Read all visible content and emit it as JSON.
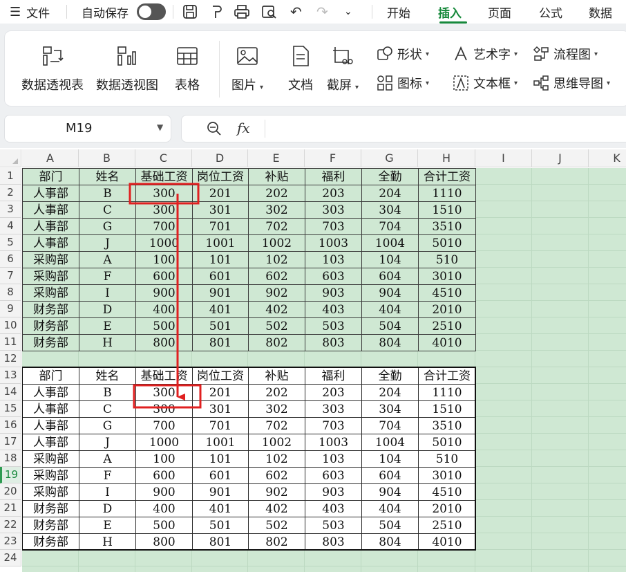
{
  "menubar": {
    "menu_label": "文件",
    "autosave_label": "自动保存",
    "tabs": [
      "开始",
      "插入",
      "页面",
      "公式",
      "数据"
    ],
    "active_tab": "插入",
    "accent_color": "#17893c"
  },
  "ribbon": {
    "big_buttons": [
      {
        "label": "数据透视表",
        "icon": "pivot-table-icon"
      },
      {
        "label": "数据透视图",
        "icon": "pivot-chart-icon"
      },
      {
        "label": "表格",
        "icon": "table-icon"
      },
      {
        "label": "图片",
        "icon": "picture-icon"
      },
      {
        "label": "文档",
        "icon": "document-icon"
      },
      {
        "label": "截屏",
        "icon": "screenshot-icon"
      }
    ],
    "small_buttons": [
      {
        "label": "形状",
        "icon": "shape-icon"
      },
      {
        "label": "图标",
        "icon": "icons-icon"
      },
      {
        "label": "艺术字",
        "icon": "wordart-icon"
      },
      {
        "label": "文本框",
        "icon": "textbox-icon"
      },
      {
        "label": "流程图",
        "icon": "flowchart-icon"
      },
      {
        "label": "思维导图",
        "icon": "mindmap-icon"
      }
    ]
  },
  "formula_bar": {
    "name_box": "M19",
    "fx_label": "fx",
    "formula": ""
  },
  "grid": {
    "columns": [
      "A",
      "B",
      "C",
      "D",
      "E",
      "F",
      "G",
      "H",
      "I",
      "J",
      "K"
    ],
    "rows": [
      "1",
      "2",
      "3",
      "4",
      "5",
      "6",
      "7",
      "8",
      "9",
      "10",
      "11",
      "12",
      "13",
      "14",
      "15",
      "16",
      "17",
      "18",
      "19",
      "20",
      "21",
      "22",
      "23",
      "24"
    ],
    "selected_row": "19",
    "sheet_color": "#cfe8d3"
  },
  "table1": {
    "headers": [
      "部门",
      "姓名",
      "基础工资",
      "岗位工资",
      "补贴",
      "福利",
      "全勤",
      "合计工资"
    ],
    "rows": [
      [
        "人事部",
        "B",
        "300",
        "201",
        "202",
        "203",
        "204",
        "1110"
      ],
      [
        "人事部",
        "C",
        "300",
        "301",
        "302",
        "303",
        "304",
        "1510"
      ],
      [
        "人事部",
        "G",
        "700",
        "701",
        "702",
        "703",
        "704",
        "3510"
      ],
      [
        "人事部",
        "J",
        "1000",
        "1001",
        "1002",
        "1003",
        "1004",
        "5010"
      ],
      [
        "采购部",
        "A",
        "100",
        "101",
        "102",
        "103",
        "104",
        "510"
      ],
      [
        "采购部",
        "F",
        "600",
        "601",
        "602",
        "603",
        "604",
        "3010"
      ],
      [
        "采购部",
        "I",
        "900",
        "901",
        "902",
        "903",
        "904",
        "4510"
      ],
      [
        "财务部",
        "D",
        "400",
        "401",
        "402",
        "403",
        "404",
        "2010"
      ],
      [
        "财务部",
        "E",
        "500",
        "501",
        "502",
        "503",
        "504",
        "2510"
      ],
      [
        "财务部",
        "H",
        "800",
        "801",
        "802",
        "803",
        "804",
        "4010"
      ]
    ]
  },
  "table2": {
    "headers": [
      "部门",
      "姓名",
      "基础工资",
      "岗位工资",
      "补贴",
      "福利",
      "全勤",
      "合计工资"
    ],
    "rows": [
      [
        "人事部",
        "B",
        "300",
        "201",
        "202",
        "203",
        "204",
        "1110"
      ],
      [
        "人事部",
        "C",
        "300",
        "301",
        "302",
        "303",
        "304",
        "1510"
      ],
      [
        "人事部",
        "G",
        "700",
        "701",
        "702",
        "703",
        "704",
        "3510"
      ],
      [
        "人事部",
        "J",
        "1000",
        "1001",
        "1002",
        "1003",
        "1004",
        "5010"
      ],
      [
        "采购部",
        "A",
        "100",
        "101",
        "102",
        "103",
        "104",
        "510"
      ],
      [
        "采购部",
        "F",
        "600",
        "601",
        "602",
        "603",
        "604",
        "3010"
      ],
      [
        "采购部",
        "I",
        "900",
        "901",
        "902",
        "903",
        "904",
        "4510"
      ],
      [
        "财务部",
        "D",
        "400",
        "401",
        "402",
        "403",
        "404",
        "2010"
      ],
      [
        "财务部",
        "E",
        "500",
        "501",
        "502",
        "503",
        "504",
        "2510"
      ],
      [
        "财务部",
        "H",
        "800",
        "801",
        "802",
        "803",
        "804",
        "4010"
      ]
    ]
  },
  "annotation": {
    "highlight_color": "#e02020",
    "from_cell": "C2",
    "to_cell": "C14"
  }
}
